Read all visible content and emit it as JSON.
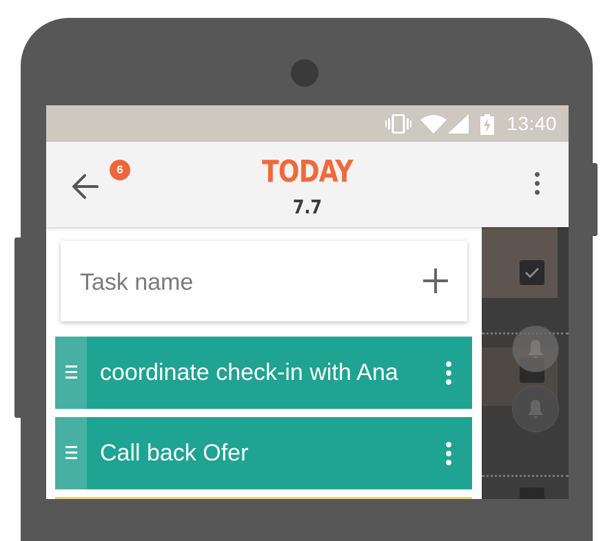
{
  "status_bar": {
    "time": "13:40",
    "icons": [
      "vibrate-icon",
      "wifi-icon",
      "signal-icon",
      "battery-charging-icon"
    ]
  },
  "app_bar": {
    "back_icon": "arrow-back-icon",
    "badge_count": "6",
    "title": "TODAY",
    "subtitle": "7.7",
    "menu_icon": "more-vert-icon"
  },
  "new_task": {
    "placeholder": "Task name",
    "add_icon": "plus-icon"
  },
  "tasks": [
    {
      "label": "coordinate check-in with Ana",
      "color": "#1fa393"
    },
    {
      "label": "Call back Ofer",
      "color": "#1fa393"
    }
  ],
  "colors": {
    "accent": "#ef6a3b",
    "task_teal": "#1fa393",
    "status_bar": "#cdc8c0",
    "next_task_yellow": "#f4cf6c"
  }
}
